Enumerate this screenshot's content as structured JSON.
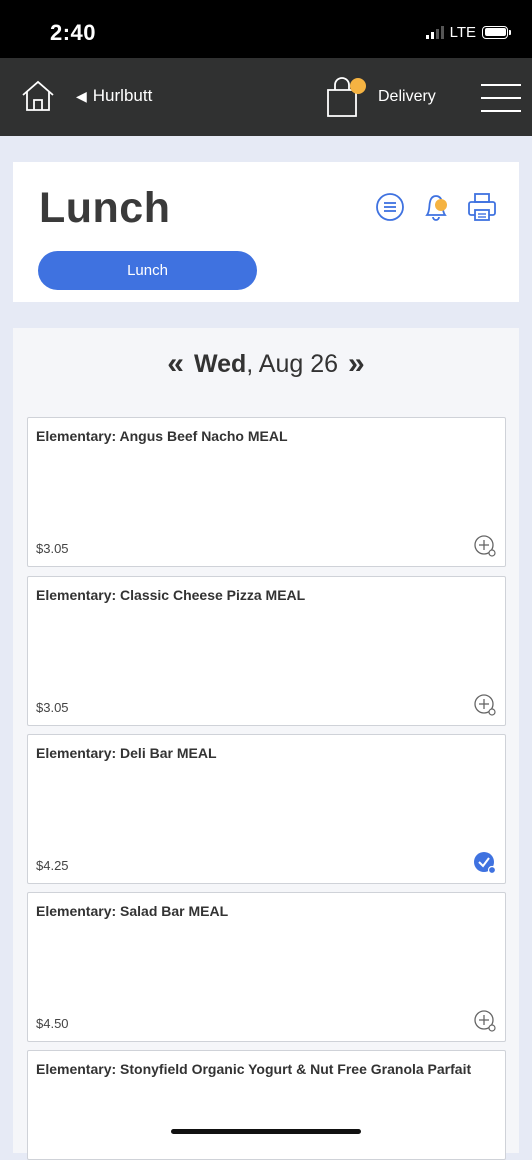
{
  "status_bar": {
    "time": "2:40",
    "network": "LTE",
    "battery_level": 1.0
  },
  "nav": {
    "back_label": "Hurlbutt",
    "delivery_label": "Delivery",
    "cart_badge_color": "#f5b342"
  },
  "header": {
    "title": "Lunch",
    "meal_button_label": "Lunch",
    "accent_color": "#3f72e0",
    "icons": [
      "list-icon",
      "bell-icon",
      "print-icon"
    ]
  },
  "date_nav": {
    "day": "Wed",
    "date": "Aug 26"
  },
  "items": [
    {
      "title": "Elementary: Angus Beef Nacho MEAL",
      "price": "$3.05",
      "selected": false
    },
    {
      "title": "Elementary: Classic Cheese Pizza MEAL",
      "price": "$3.05",
      "selected": false
    },
    {
      "title": "Elementary: Deli Bar MEAL",
      "price": "$4.25",
      "selected": true
    },
    {
      "title": "Elementary: Salad Bar MEAL",
      "price": "$4.50",
      "selected": false
    },
    {
      "title": "Elementary: Stonyfield Organic Yogurt & Nut Free Granola Parfait",
      "price": "",
      "selected": false
    }
  ]
}
